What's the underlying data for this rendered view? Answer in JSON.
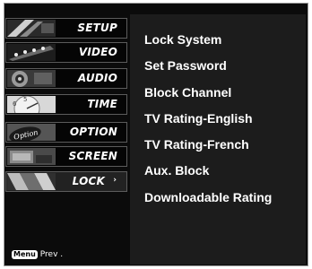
{
  "menu": {
    "items": [
      {
        "label": "SETUP",
        "icon": "setup-icon"
      },
      {
        "label": "VIDEO",
        "icon": "video-icon"
      },
      {
        "label": "AUDIO",
        "icon": "audio-icon"
      },
      {
        "label": "TIME",
        "icon": "time-icon"
      },
      {
        "label": "OPTION",
        "icon": "option-icon"
      },
      {
        "label": "SCREEN",
        "icon": "screen-icon"
      },
      {
        "label": "LOCK",
        "icon": "lock-icon",
        "selected": true
      }
    ],
    "arrow": "›"
  },
  "hint": {
    "key": "Menu",
    "text": "Prev ."
  },
  "submenu": {
    "items": [
      "Lock System",
      "Set Password",
      "Block Channel",
      "TV Rating-English",
      "TV Rating-French",
      "Aux. Block",
      "Downloadable Rating"
    ]
  },
  "colors": {
    "panel": "#0b0b0b",
    "submenu": "#1c1c1c",
    "text": "#ffffff"
  }
}
